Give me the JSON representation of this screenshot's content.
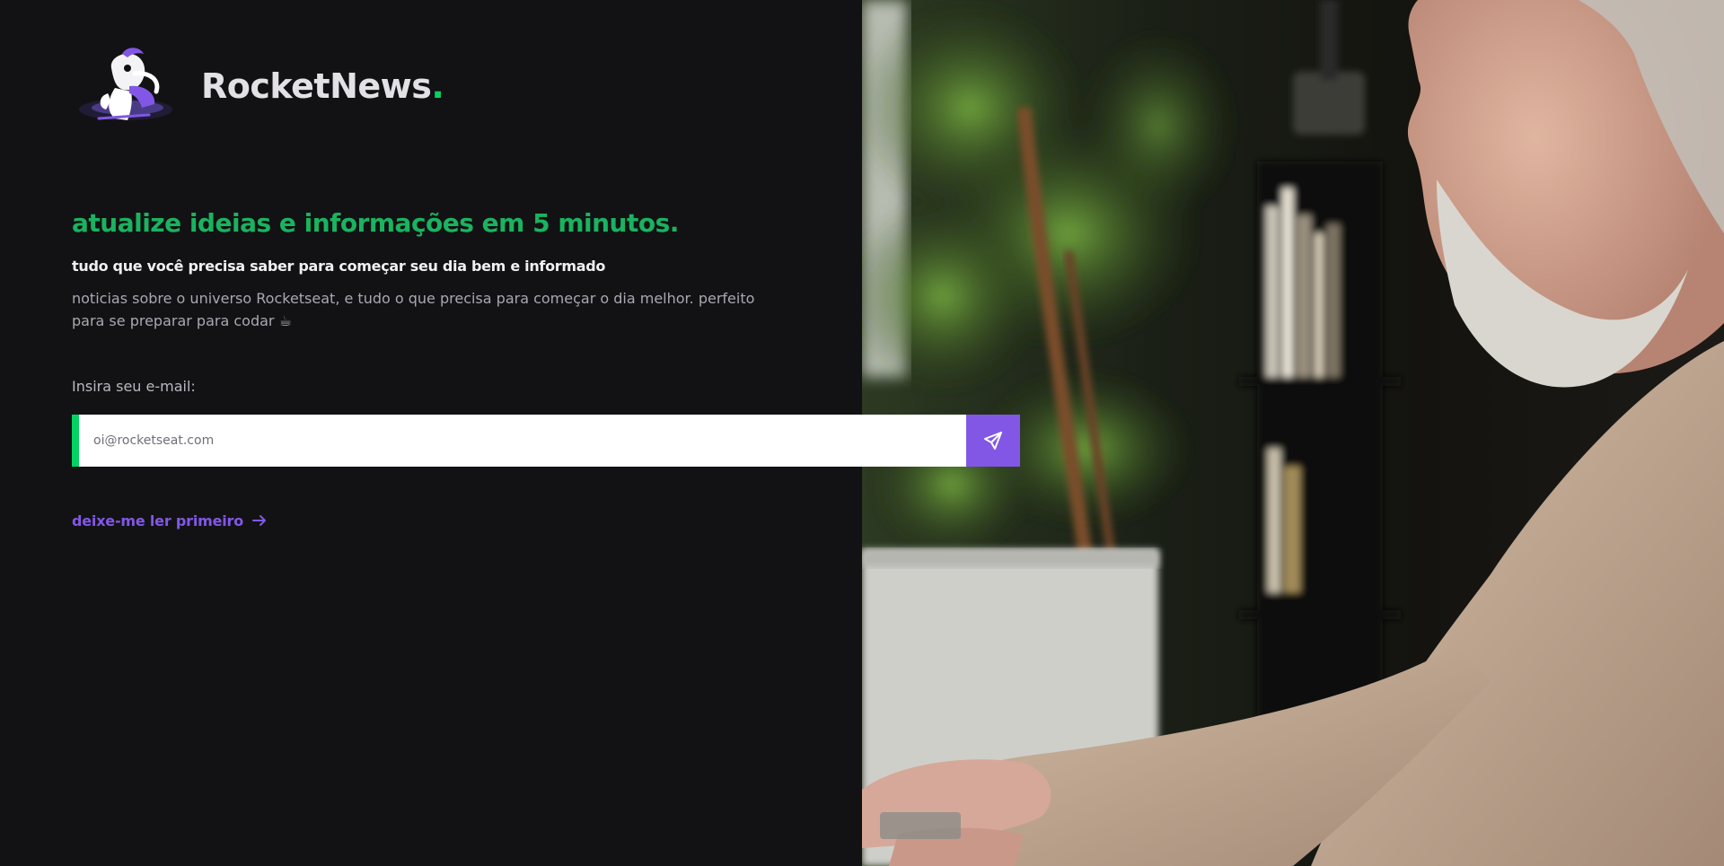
{
  "brand": {
    "name": "RocketNews",
    "dot": ".",
    "logo_icon": "astronaut-mascot-logo",
    "accent_color": "#04d361"
  },
  "hero": {
    "headline": "atualize ideias e informações em 5 minutos.",
    "subheadline": "tudo que você precisa saber para começar seu dia bem e informado",
    "description": "noticias sobre o universo Rocketseat, e tudo o que precisa para começar o dia melhor. perfeito para se preparar para codar ☕"
  },
  "form": {
    "email_label": "Insira seu e-mail:",
    "email_placeholder": "oi@rocketseat.com",
    "submit_icon": "send-paper-plane-icon",
    "submit_color": "#8257e5"
  },
  "links": {
    "read_first": "deixe-me ler primeiro",
    "read_first_icon": "arrow-right-icon"
  },
  "photo": {
    "subject": "photo-man-typing-at-desk"
  },
  "colors": {
    "background": "#121214",
    "green": "#04d361",
    "purple": "#8257e5"
  }
}
